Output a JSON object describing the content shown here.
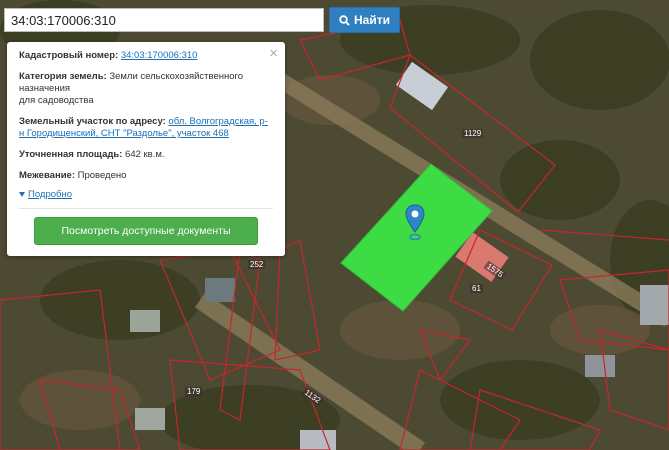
{
  "search": {
    "value": "34:03:170006:310",
    "button_label": "Найти",
    "button_icon": "search-icon"
  },
  "popup": {
    "cadastral_label": "Кадастровый номер:",
    "cadastral_value": "34:03:170006:310",
    "category_label": "Категория земель:",
    "category_line1": "Земли сельскохозяйственного",
    "category_line2": "назначения",
    "category_line3": "для садоводства",
    "address_label": "Земельный участок по адресу:",
    "address_value": "обл. Волгоградская, р-н Городищенский, СНТ \"Раздолье\", участок 468",
    "area_label": "Уточненная площадь:",
    "area_value": "642 кв.м.",
    "survey_label": "Межевание:",
    "survey_value": "Проведено",
    "more_label": "Подробно",
    "docs_button": "Посмотреть доступные документы",
    "close_symbol": "×"
  },
  "map": {
    "parcel_labels": [
      "1129",
      "1575",
      "61",
      "252",
      "179",
      "1132"
    ],
    "parcel_fill": "#3ddc45",
    "boundary_color": "#c8252c",
    "marker_color": "#2e86c8",
    "marker_icon": "map-pin-icon"
  }
}
